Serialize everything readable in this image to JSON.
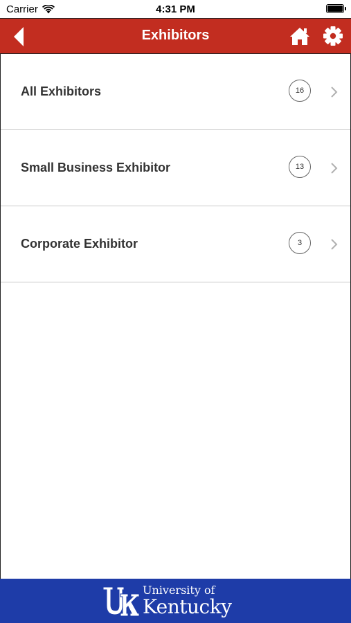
{
  "status_bar": {
    "carrier": "Carrier",
    "time": "4:31 PM"
  },
  "header": {
    "title": "Exhibitors",
    "color": "#c22d20"
  },
  "list": {
    "items": [
      {
        "label": "All Exhibitors",
        "count": "16"
      },
      {
        "label": "Small Business Exhibitor",
        "count": "13"
      },
      {
        "label": "Corporate Exhibitor",
        "count": "3"
      }
    ]
  },
  "footer": {
    "brand_line1": "University of",
    "brand_line2": "Kentucky",
    "color": "#1e3ca8"
  },
  "icons": [
    "wifi-icon",
    "battery-icon",
    "back-arrow-icon",
    "home-icon",
    "gear-icon",
    "chevron-right-icon",
    "uk-logo"
  ]
}
